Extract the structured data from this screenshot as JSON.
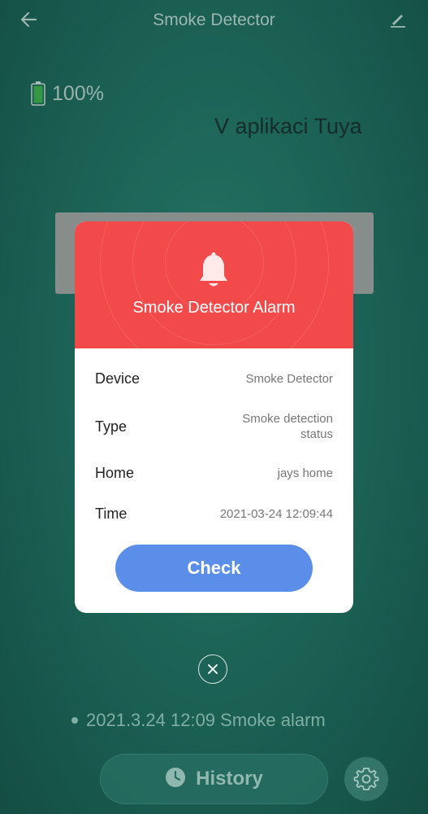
{
  "header": {
    "title": "Smoke Detector",
    "back_icon": "back-arrow-icon",
    "edit_icon": "edit-pencil-icon"
  },
  "battery": {
    "level": 100,
    "label": "100%",
    "icon": "battery-icon"
  },
  "watermark": "V aplikaci Tuya",
  "alarm_dialog": {
    "icon": "bell-icon",
    "title": "Smoke Detector Alarm",
    "header_color": "#f24a4a",
    "rows": [
      {
        "label": "Device",
        "value": "Smoke Detector"
      },
      {
        "label": "Type",
        "value": "Smoke detection\nstatus"
      },
      {
        "label": "Home",
        "value": "jays home"
      },
      {
        "label": "Time",
        "value": "2021-03-24 12:09:44"
      }
    ],
    "check_label": "Check",
    "check_color": "#5b8ee8"
  },
  "close_icon": "close-icon",
  "last_event": "2021.3.24 12:09 Smoke alarm",
  "history": {
    "label": "History",
    "icon": "clock-icon"
  },
  "settings_icon": "gear-icon"
}
